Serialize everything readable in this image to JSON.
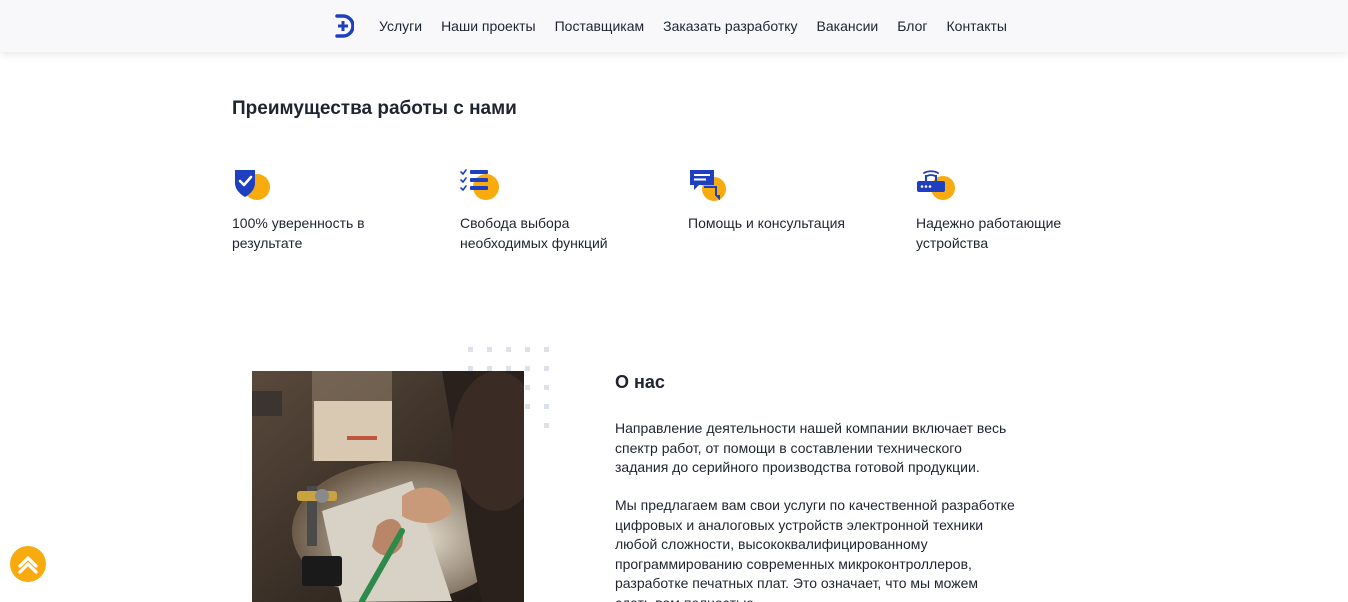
{
  "nav": {
    "items": [
      "Услуги",
      "Наши проекты",
      "Поставщикам",
      "Заказать разработку",
      "Вакансии",
      "Блог",
      "Контакты"
    ]
  },
  "advantages": {
    "title": "Преимущества работы с нами",
    "items": [
      {
        "label": "100% уверенность в результате",
        "icon": "shield-check-icon"
      },
      {
        "label": "Свобода выбора необходимых функций",
        "icon": "checklist-icon"
      },
      {
        "label": "Помощь и консультация",
        "icon": "chat-bubbles-icon"
      },
      {
        "label": "Надежно работающие устройства",
        "icon": "router-device-icon"
      }
    ]
  },
  "about": {
    "title": "О нас",
    "p1": "Направление деятельности нашей компании включает весь спектр работ, от помощи в составлении технического задания до серийного производства готовой продукции.",
    "p2": "Мы предлагаем вам свои услуги по качественной разработке цифровых и аналоговых устройств электронной техники любой сложности, высококвалифицированному программированию современных микроконтроллеров, разработке печатных плат. Это означает, что мы можем сдать вам полностью"
  },
  "colors": {
    "accent": "#f7ab0f",
    "brand": "#1e3fbf",
    "text": "#1f2430"
  }
}
